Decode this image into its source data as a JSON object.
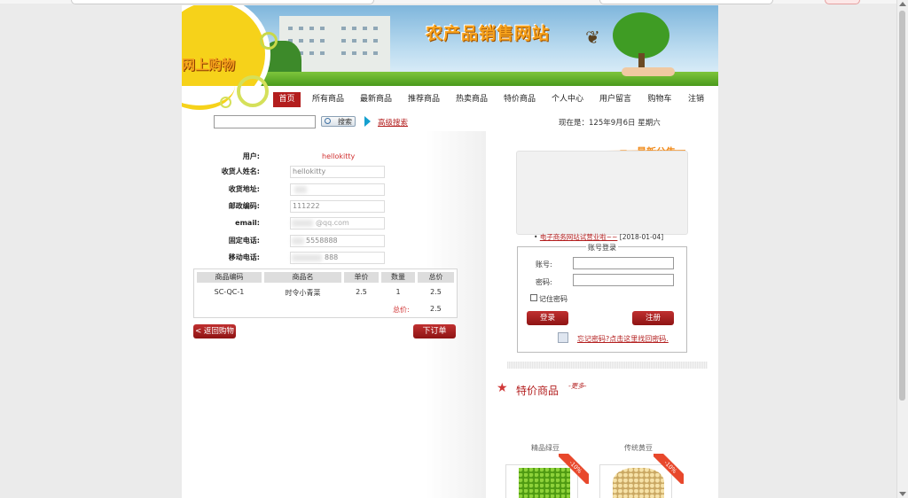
{
  "site": {
    "title": "农产品销售网站",
    "shop_title": "网上购物"
  },
  "nav": [
    {
      "label": "首页",
      "active": true
    },
    {
      "label": "所有商品"
    },
    {
      "label": "最新商品"
    },
    {
      "label": "推荐商品"
    },
    {
      "label": "热卖商品"
    },
    {
      "label": "特价商品"
    },
    {
      "label": "个人中心"
    },
    {
      "label": "用户留言"
    },
    {
      "label": "购物车"
    },
    {
      "label": "注销"
    }
  ],
  "search": {
    "button": "搜索",
    "advanced": "高级搜索",
    "date": "现在是：125年9月6日 星期六"
  },
  "order_form": {
    "user_label": "用户:",
    "user_value": "hellokitty",
    "name_label": "收货人姓名:",
    "name_value": "hellokitty",
    "address_label": "收货地址:",
    "zip_label": "邮政编码:",
    "zip_value": "111222",
    "email_label": "email:",
    "email_suffix": "@qq.com",
    "phone_label": "固定电话:",
    "phone_value": "5558888",
    "mobile_label": "移动电话:",
    "mobile_value": "888"
  },
  "order_table": {
    "headers": [
      "商品编码",
      "商品名",
      "单价",
      "数量",
      "总价"
    ],
    "rows": [
      [
        "SC-QC-1",
        "时令小青菜",
        "2.5",
        "1",
        "2.5"
      ]
    ],
    "total_label": "总价:",
    "total_value": "2.5"
  },
  "buttons": {
    "back_cart": "< 返回购物车",
    "place_order": "下订单"
  },
  "notice": {
    "title": "最新公告",
    "item_link": "电子商务网站试营业啦~~",
    "item_date": "[2018-01-04]"
  },
  "login": {
    "legend": "账号登录",
    "account_label": "账号:",
    "password_label": "密码:",
    "remember_label": "记住密码",
    "login_button": "登录",
    "register_button": "注册",
    "forgot_link": "忘记密码?点击这里找回密码."
  },
  "specials": {
    "title": "特价商品",
    "more": "-更多-",
    "products": [
      {
        "name": "精品绿豆",
        "discount": "-10%"
      },
      {
        "name": "传统黄豆",
        "discount": "-10%"
      }
    ]
  },
  "colors": {
    "accent_red": "#b31e1e",
    "link_red": "#d03030",
    "orange": "#f7a21c"
  }
}
